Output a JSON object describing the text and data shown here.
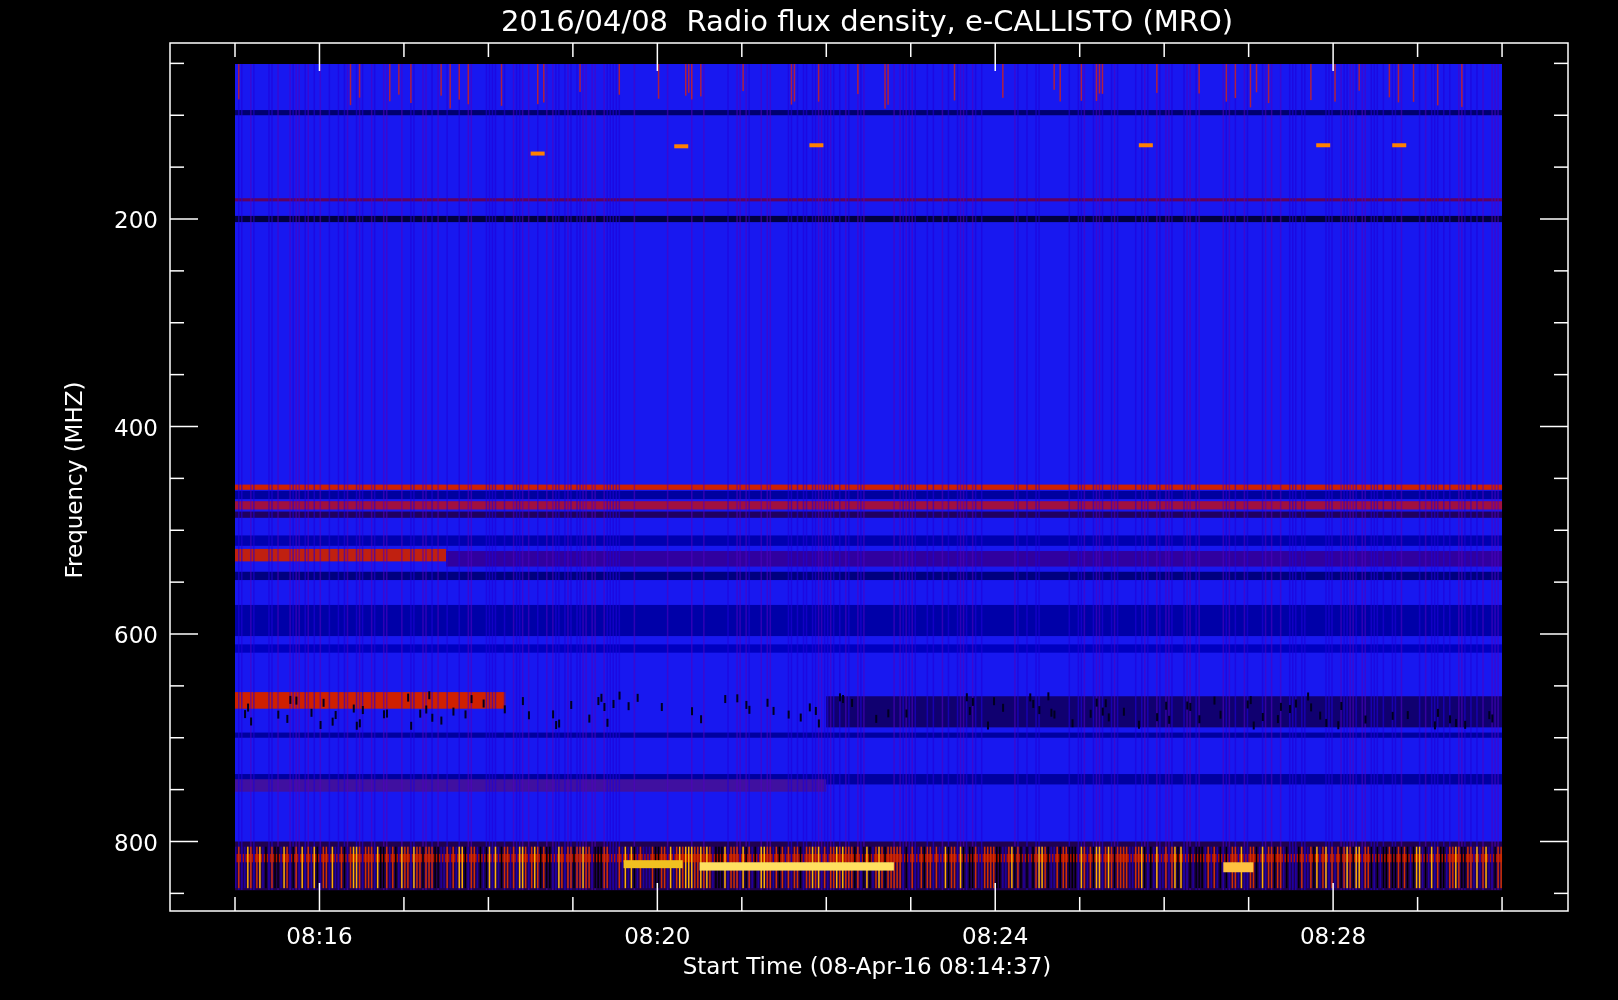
{
  "title": "2016/04/08  Radio flux density, e-CALLISTO (MRO)",
  "y_axis": {
    "label": "Frequency (MHZ)",
    "ticks": [
      "200",
      "400",
      "600",
      "800"
    ]
  },
  "x_axis": {
    "label": "Start Time (08-Apr-16 08:14:37)",
    "ticks": [
      "08:16",
      "08:20",
      "08:24",
      "08:28"
    ]
  }
}
